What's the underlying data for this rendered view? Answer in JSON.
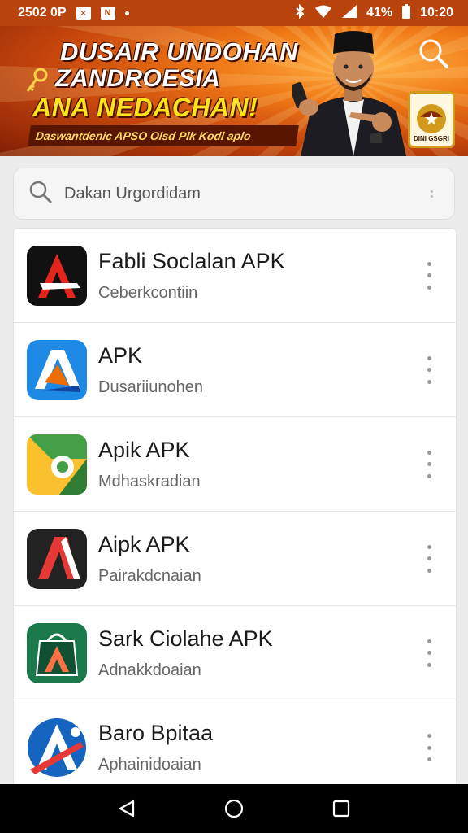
{
  "status_bar": {
    "left_text": "2502 0P",
    "time": "10:20",
    "battery": "41%",
    "icons": [
      "notification-box-icon",
      "notification-box-icon",
      "dot-icon",
      "bluetooth-icon",
      "wifi-icon",
      "signal-icon",
      "battery-icon"
    ]
  },
  "banner": {
    "title_line1": "DUSAIR UNDOHAN",
    "title_line2": "ZANDROESIA",
    "title_line3": "ANA NEDACHAN!",
    "subtitle": "Daswantdenic APSO Olsd Plk Kodl aplo",
    "emblem_label": "DINI GSGRI",
    "accent_color": "#f07a17",
    "highlight_color": "#ffe21a"
  },
  "search": {
    "placeholder": "Dakan Urgordidam"
  },
  "apps": [
    {
      "name": "Fabli Soclalan APK",
      "subtitle": "Ceberkcontiin",
      "icon": "black-red-a-icon"
    },
    {
      "name": "APK",
      "subtitle": "Dusariiunohen",
      "icon": "blue-a-icon"
    },
    {
      "name": "Apik APK",
      "subtitle": "Mdhaskradian",
      "icon": "green-yellow-icon"
    },
    {
      "name": "Aipk APK",
      "subtitle": "Pairakdcnaian",
      "icon": "dark-red-a-icon"
    },
    {
      "name": "Sark Ciolahe APK",
      "subtitle": "Adnakkdoaian",
      "icon": "green-bag-a-icon"
    },
    {
      "name": "Baro Bpitaa",
      "subtitle": "Aphainidoaian",
      "icon": "blue-shield-a-icon"
    }
  ],
  "nav": {
    "icons": [
      "back-icon",
      "home-icon",
      "recents-icon"
    ]
  }
}
